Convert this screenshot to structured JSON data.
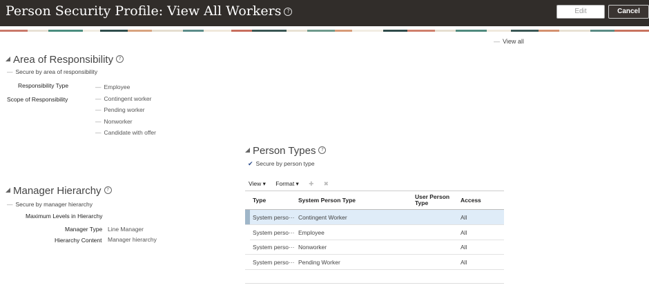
{
  "header": {
    "title": "Person Security Profile: View All Workers",
    "edit_label": "Edit",
    "cancel_label": "Cancel"
  },
  "view_all": "View all",
  "aor": {
    "title": "Area of Responsibility",
    "secure_label": "Secure by area of responsibility",
    "responsibility_type_label": "Responsibility Type",
    "scope_label": "Scope of Responsibility",
    "types": [
      "Employee",
      "Contingent worker",
      "Pending worker",
      "Nonworker",
      "Candidate with offer"
    ]
  },
  "manager": {
    "title": "Manager Hierarchy",
    "secure_label": "Secure by manager hierarchy",
    "max_levels_label": "Maximum Levels in Hierarchy",
    "manager_type_label": "Manager Type",
    "manager_type_value": "Line Manager",
    "hierarchy_content_label": "Hierarchy Content",
    "hierarchy_content_value": "Manager hierarchy"
  },
  "person_types": {
    "title": "Person Types",
    "secure_label": "Secure by person type",
    "toolbar": {
      "view_label": "View ▾",
      "format_label": "Format ▾"
    },
    "columns": {
      "type": "Type",
      "system_person_type": "System Person Type",
      "user_person_type": "User Person Type",
      "access": "Access"
    },
    "rows": [
      {
        "type": "System perso···",
        "system": "Contingent Worker",
        "user": "",
        "access": "All"
      },
      {
        "type": "System perso···",
        "system": "Employee",
        "user": "",
        "access": "All"
      },
      {
        "type": "System perso···",
        "system": "Nonworker",
        "user": "",
        "access": "All"
      },
      {
        "type": "System perso···",
        "system": "Pending Worker",
        "user": "",
        "access": "All"
      }
    ]
  }
}
